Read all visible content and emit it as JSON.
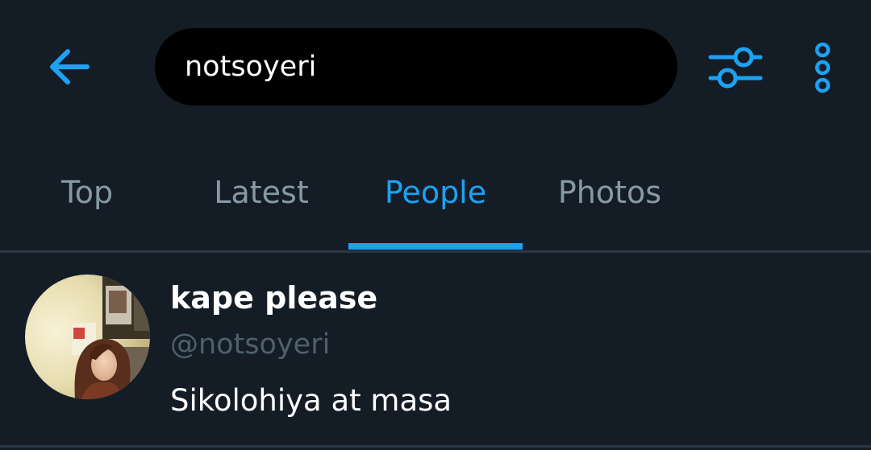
{
  "colors": {
    "background": "#141d26",
    "accent": "#1da1f2",
    "search_bg": "#000000",
    "tab_inactive": "#8899a6",
    "handle": "#4f5f6d",
    "text": "#ffffff"
  },
  "header": {
    "back_icon": "arrow-left-icon",
    "search": {
      "value": "notsoyeri"
    },
    "filter_icon": "sliders-icon",
    "more_icon": "more-vertical-icon"
  },
  "tabs": [
    {
      "label": "Top",
      "active": false
    },
    {
      "label": "Latest",
      "active": false
    },
    {
      "label": "People",
      "active": true
    },
    {
      "label": "Photos",
      "active": false
    }
  ],
  "results": [
    {
      "display_name": "kape please",
      "handle": "@notsoyeri",
      "bio": "Sikolohiya at masa"
    }
  ]
}
